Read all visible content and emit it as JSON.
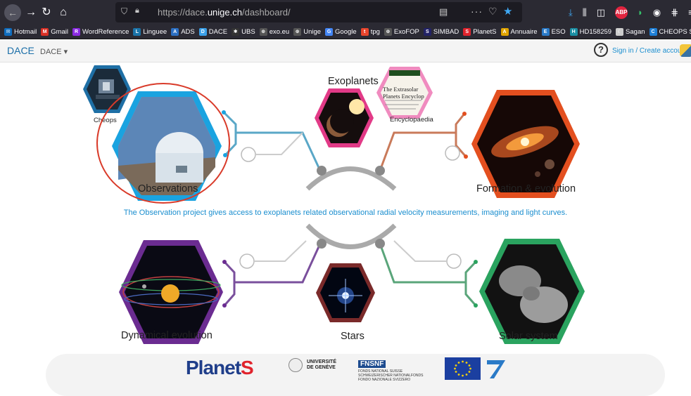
{
  "browser": {
    "url_prefix": "https://dace.",
    "url_host": "unige.ch",
    "url_path": "/dashboard/",
    "bookmarks": [
      {
        "label": "Hotmail",
        "color": "#0f6cbd",
        "glyph": "✉"
      },
      {
        "label": "Gmail",
        "color": "#d93025",
        "glyph": "M"
      },
      {
        "label": "WordReference",
        "color": "#8a2be2",
        "glyph": "R"
      },
      {
        "label": "Linguee",
        "color": "#1a73a8",
        "glyph": "L"
      },
      {
        "label": "ADS",
        "color": "#2b6fc2",
        "glyph": "A"
      },
      {
        "label": "DACE",
        "color": "#3aa0e8",
        "glyph": "D"
      },
      {
        "label": "UBS",
        "color": "#333",
        "glyph": "✱"
      },
      {
        "label": "exo.eu",
        "color": "#555",
        "glyph": "⊕"
      },
      {
        "label": "Unige",
        "color": "#555",
        "glyph": "⊕"
      },
      {
        "label": "Google",
        "color": "#4285f4",
        "glyph": "G"
      },
      {
        "label": "tpg",
        "color": "#e8452c",
        "glyph": "t"
      },
      {
        "label": "ExoFOP",
        "color": "#555",
        "glyph": "⊕"
      },
      {
        "label": "SIMBAD",
        "color": "#226",
        "glyph": "S"
      },
      {
        "label": "PlanetS",
        "color": "#e0232c",
        "glyph": "S"
      },
      {
        "label": "Annuaire",
        "color": "#e0a400",
        "glyph": "A"
      },
      {
        "label": "ESO",
        "color": "#2a7ac7",
        "glyph": "E"
      },
      {
        "label": "HD158259",
        "color": "#1b8fa3",
        "glyph": "H"
      },
      {
        "label": "Sagan",
        "color": "#ccc",
        "glyph": "☾"
      },
      {
        "label": "CHEOPS ST",
        "color": "#1e7fd6",
        "glyph": "C"
      }
    ]
  },
  "app": {
    "brand": "DACE",
    "menu_label": "DACE ▾",
    "signin": "Sign in / Create account"
  },
  "sections": {
    "cheops": "Cheops",
    "observations": "Observations",
    "exoplanets": "Exoplanets",
    "encyclopaedia": "Encyclopaedia",
    "formation": "Formation & evolution",
    "dynamical": "Dynamical evolution",
    "stars": "Stars",
    "solar": "Solar system"
  },
  "encyclopaedia_card": {
    "title_line1": "The Extrasolar",
    "title_line2": "Planets Encyclop"
  },
  "description": "The Observation project gives access to exoplanets related observational radial velocity measurements, imaging and light curves.",
  "footer": {
    "planets_logo": "Planet",
    "planets_logo_s": "S",
    "unige_line1": "UNIVERSITÉ",
    "unige_line2": "DE GENÈVE",
    "fns_mark": "FNSNF",
    "fns_line1": "FONDS NATIONAL SUISSE",
    "fns_line2": "SCHWEIZERISCHER NATIONALFONDS",
    "fns_line3": "FONDO NAZIONALE SVIZZERO"
  },
  "colors": {
    "observations": "#1aa3e0",
    "exoplanets": "#e23a87",
    "formation": "#e34f1f",
    "dynamical": "#6b2c91",
    "stars": "#7a2a2a",
    "solar": "#2aa35f",
    "cheops": "#1e6fa5",
    "highlight": "#d93b2a",
    "link": "#1a8ecf"
  }
}
